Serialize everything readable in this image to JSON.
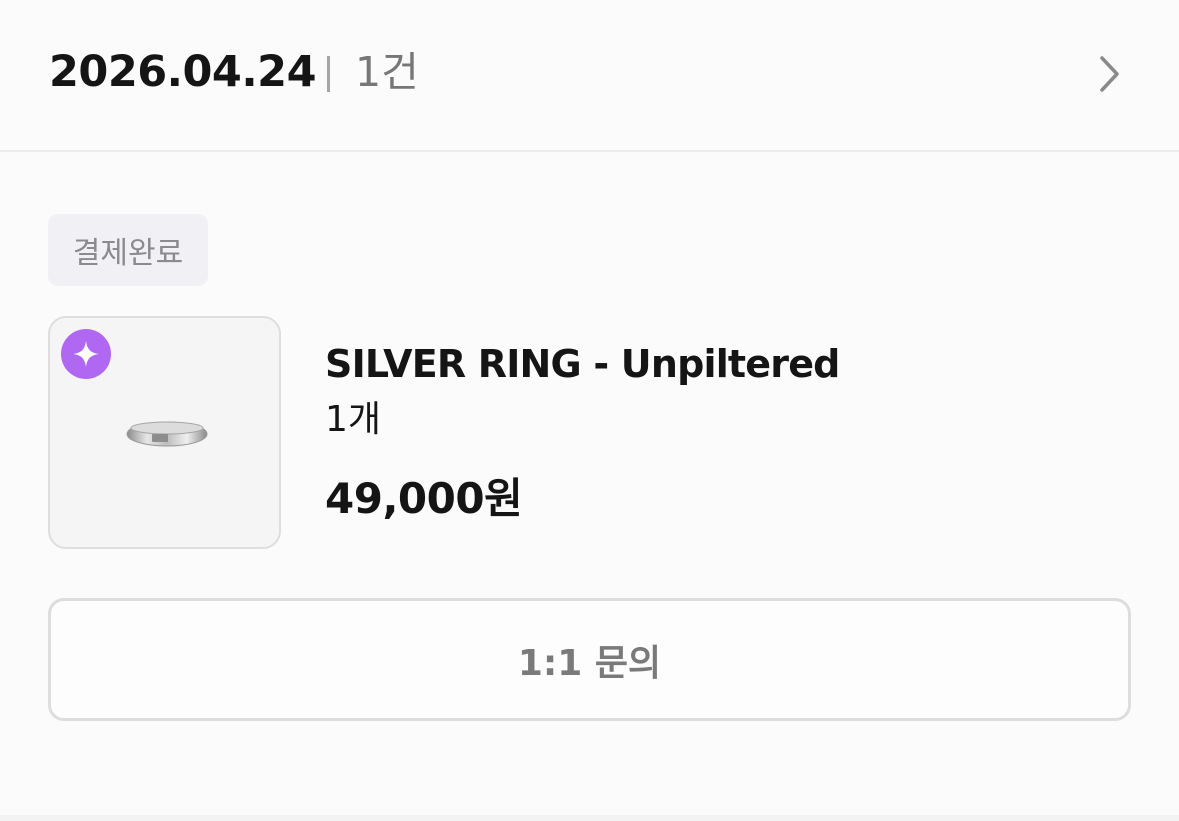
{
  "header": {
    "date": "2026.04.24",
    "count": "1건",
    "chevron_icon": "chevron-right-icon"
  },
  "order": {
    "status": "결제완료",
    "product": {
      "name": "SILVER RING - Unpiltered",
      "quantity": "1개",
      "price": "49,000원",
      "badge_icon": "sparkle-icon",
      "image_icon": "silver-ring-image"
    }
  },
  "actions": {
    "inquiry_label": "1:1 문의"
  },
  "colors": {
    "background": "#fbfbfb",
    "badge_purple": "#b068f2",
    "status_bg": "#f1f1f5",
    "muted_text": "#7a7a7a",
    "border": "#dddddd"
  }
}
